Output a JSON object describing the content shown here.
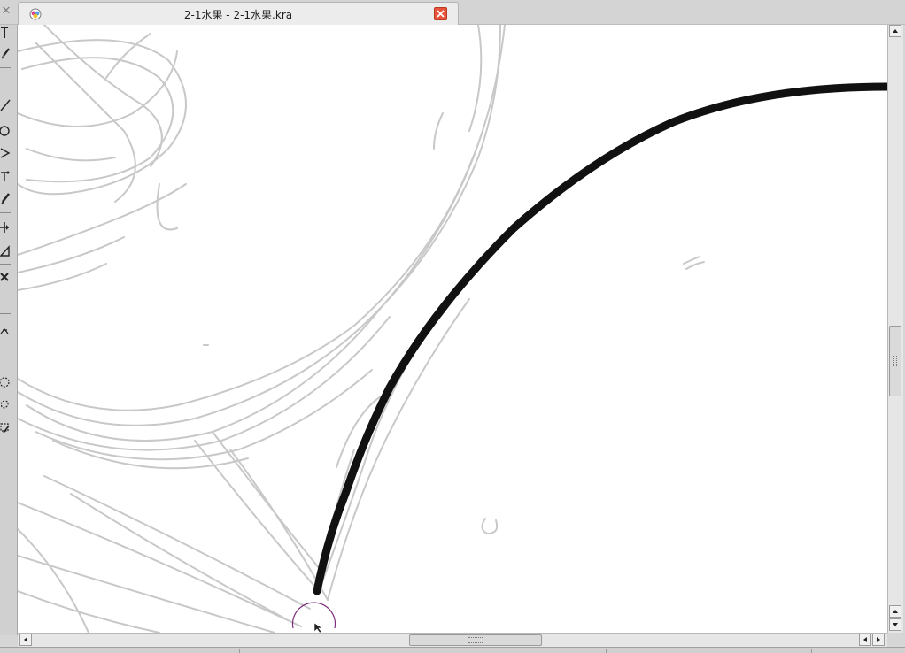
{
  "tab": {
    "title": "2-1水果 - 2-1水果.kra",
    "app_icon": "krita-logo-icon",
    "close_icon": "close-icon",
    "close_color": "#e8553a"
  },
  "tabbar": {
    "close_glyph": "✕",
    "close_icon": "close-icon"
  },
  "toolbox": {
    "tools": [
      {
        "name": "text-tool",
        "icon": "text-icon"
      },
      {
        "name": "freehand-brush-tool",
        "icon": "brush-icon"
      },
      {
        "name": "line-tool",
        "icon": "line-icon"
      },
      {
        "name": "ellipse-tool",
        "icon": "ellipse-icon"
      },
      {
        "name": "polyline-tool",
        "icon": "polyline-icon"
      },
      {
        "name": "bezier-curve-tool",
        "icon": "bezier-icon"
      },
      {
        "name": "dynamic-brush-tool",
        "icon": "dynamic-brush-icon"
      },
      {
        "name": "move-tool",
        "icon": "move-icon"
      },
      {
        "name": "transform-tool",
        "icon": "transform-icon"
      },
      {
        "name": "crop-tool",
        "icon": "crop-icon"
      },
      {
        "name": "assistant-tool",
        "icon": "assistant-icon"
      },
      {
        "name": "elliptical-selection-tool",
        "icon": "ellipse-select-icon"
      },
      {
        "name": "freehand-selection-tool",
        "icon": "lasso-select-icon"
      },
      {
        "name": "similar-color-selection-tool",
        "icon": "magic-select-icon"
      }
    ]
  },
  "canvas": {
    "background": "#ffffff",
    "sketch_color": "#c8c8c8",
    "ink_color": "#111111",
    "cursor_icon": "brush-outline-cursor-icon",
    "cursor_color": "#7a2a7a"
  },
  "scrollbars": {
    "up_icon": "arrow-up-icon",
    "down_icon": "arrow-down-icon",
    "left_icon": "arrow-left-icon",
    "right_icon": "arrow-right-icon"
  }
}
